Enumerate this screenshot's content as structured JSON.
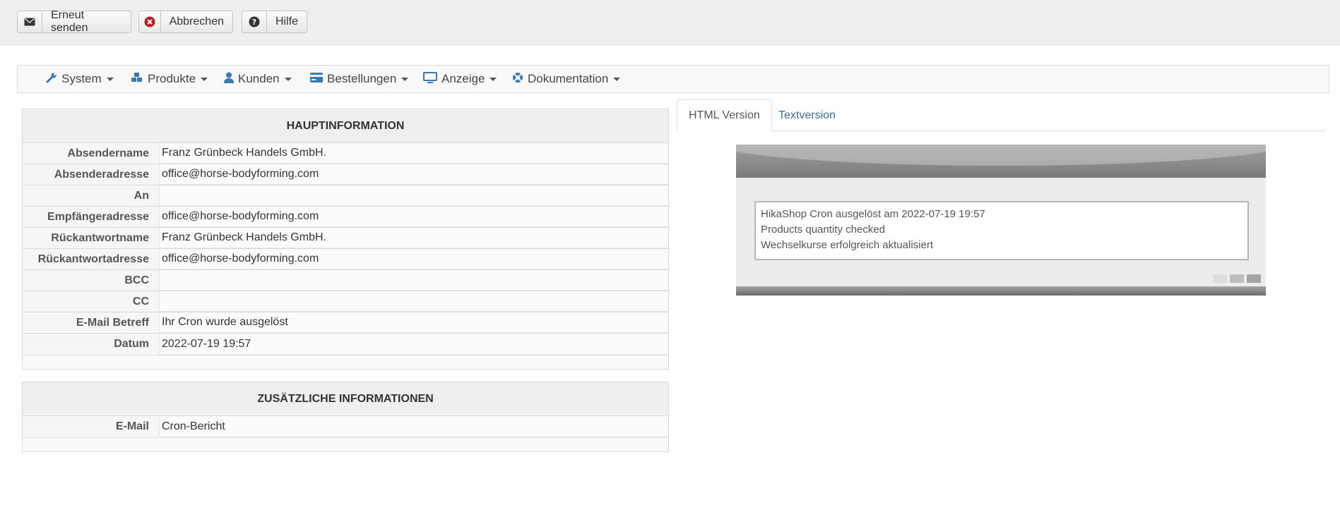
{
  "toolbar": {
    "resend_label": "Erneut senden",
    "cancel_label": "Abbrechen",
    "help_label": "Hilfe"
  },
  "menu": [
    {
      "label": "System",
      "icon": "wrench-icon"
    },
    {
      "label": "Produkte",
      "icon": "cubes-icon"
    },
    {
      "label": "Kunden",
      "icon": "user-icon"
    },
    {
      "label": "Bestellungen",
      "icon": "credit-card-icon"
    },
    {
      "label": "Anzeige",
      "icon": "monitor-icon"
    },
    {
      "label": "Dokumentation",
      "icon": "lifebuoy-icon"
    }
  ],
  "main_info": {
    "title": "HAUPTINFORMATION",
    "rows": [
      {
        "key": "Absendername",
        "value": "Franz Grünbeck Handels GmbH."
      },
      {
        "key": "Absenderadresse",
        "value": "office@horse-bodyforming.com"
      },
      {
        "key": "An",
        "value": ""
      },
      {
        "key": "Empfängeradresse",
        "value": "office@horse-bodyforming.com"
      },
      {
        "key": "Rückantwortname",
        "value": "Franz Grünbeck Handels GmbH."
      },
      {
        "key": "Rückantwortadresse",
        "value": "office@horse-bodyforming.com"
      },
      {
        "key": "BCC",
        "value": ""
      },
      {
        "key": "CC",
        "value": ""
      },
      {
        "key": "E-Mail Betreff",
        "value": "Ihr Cron wurde ausgelöst"
      },
      {
        "key": "Datum",
        "value": "2022-07-19 19:57"
      }
    ]
  },
  "extra_info": {
    "title": "ZUSÄTZLICHE INFORMATIONEN",
    "rows": [
      {
        "key": "E-Mail",
        "value": "Cron-Bericht"
      }
    ]
  },
  "tabs": {
    "html": "HTML Version",
    "text": "Textversion"
  },
  "preview": {
    "lines": [
      "HikaShop Cron ausgelöst am 2022-07-19 19:57",
      "Products quantity checked",
      "Wechselkurse erfolgreich aktualisiert"
    ]
  },
  "colors": {
    "accent": "#3b6ca3",
    "icon_blue": "#3a78b5",
    "cancel_red": "#b52020"
  }
}
